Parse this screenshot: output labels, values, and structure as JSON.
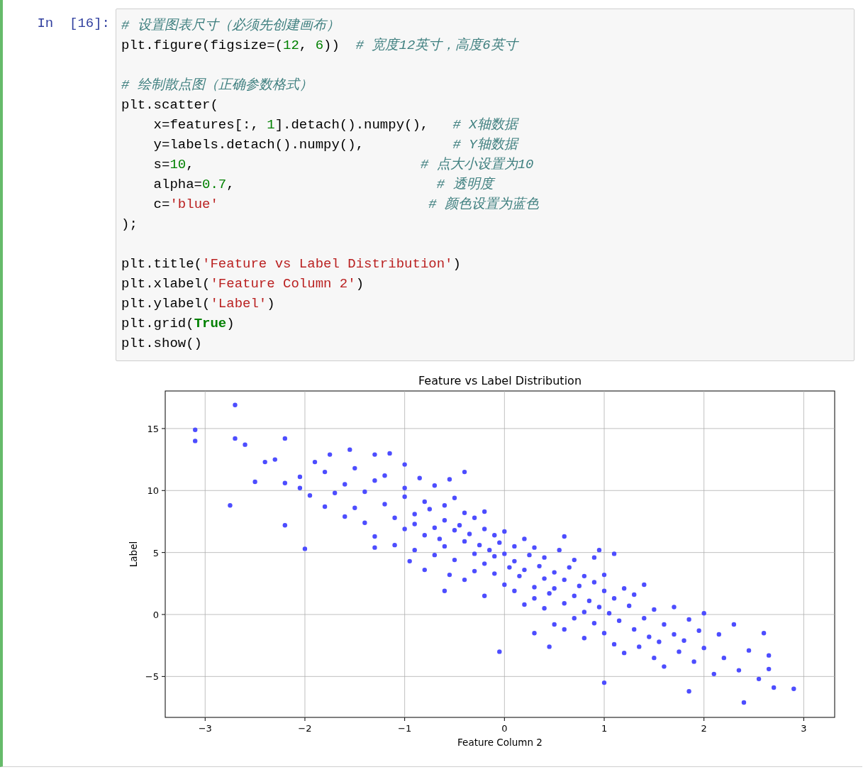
{
  "cell": {
    "prompt": "In  [16]:",
    "code_blocks": [
      [
        [
          {
            "kind": "comment",
            "text": "# 设置图表尺寸（必须先创建画布）"
          }
        ],
        [
          {
            "kind": "plain",
            "text": "plt.figure(figsize=("
          },
          {
            "kind": "number",
            "text": "12"
          },
          {
            "kind": "plain",
            "text": ", "
          },
          {
            "kind": "number",
            "text": "6"
          },
          {
            "kind": "plain",
            "text": "))  "
          },
          {
            "kind": "comment",
            "text": "# 宽度12英寸，高度6英寸"
          }
        ]
      ],
      [
        [
          {
            "kind": "comment",
            "text": "# 绘制散点图（正确参数格式）"
          }
        ],
        [
          {
            "kind": "plain",
            "text": "plt.scatter("
          }
        ],
        [
          {
            "kind": "plain",
            "text": "    x=features[:, "
          },
          {
            "kind": "number",
            "text": "1"
          },
          {
            "kind": "plain",
            "text": "].detach().numpy(),   "
          },
          {
            "kind": "comment",
            "text": "# X轴数据"
          }
        ],
        [
          {
            "kind": "plain",
            "text": "    y=labels.detach().numpy(),           "
          },
          {
            "kind": "comment",
            "text": "# Y轴数据"
          }
        ],
        [
          {
            "kind": "plain",
            "text": "    s="
          },
          {
            "kind": "number",
            "text": "10"
          },
          {
            "kind": "plain",
            "text": ",                            "
          },
          {
            "kind": "comment",
            "text": "# 点大小设置为10"
          }
        ],
        [
          {
            "kind": "plain",
            "text": "    alpha="
          },
          {
            "kind": "number",
            "text": "0.7"
          },
          {
            "kind": "plain",
            "text": ",                         "
          },
          {
            "kind": "comment",
            "text": "# 透明度"
          }
        ],
        [
          {
            "kind": "plain",
            "text": "    c="
          },
          {
            "kind": "string",
            "text": "'blue'"
          },
          {
            "kind": "comment",
            "text": "                          # 颜色设置为蓝色"
          }
        ],
        [
          {
            "kind": "plain",
            "text": ");"
          }
        ]
      ],
      [
        [
          {
            "kind": "plain",
            "text": "plt.title("
          },
          {
            "kind": "string",
            "text": "'Feature vs Label Distribution'"
          },
          {
            "kind": "plain",
            "text": ")"
          }
        ],
        [
          {
            "kind": "plain",
            "text": "plt.xlabel("
          },
          {
            "kind": "string",
            "text": "'Feature Column 2'"
          },
          {
            "kind": "plain",
            "text": ")"
          }
        ],
        [
          {
            "kind": "plain",
            "text": "plt.ylabel("
          },
          {
            "kind": "string",
            "text": "'Label'"
          },
          {
            "kind": "plain",
            "text": ")"
          }
        ],
        [
          {
            "kind": "plain",
            "text": "plt.grid("
          },
          {
            "kind": "keyword",
            "text": "True"
          },
          {
            "kind": "plain",
            "text": ")"
          }
        ],
        [
          {
            "kind": "plain",
            "text": "plt.show()"
          }
        ]
      ]
    ],
    "output": {
      "chart_data": {
        "type": "scatter",
        "title": "Feature vs Label Distribution",
        "xlabel": "Feature Column 2",
        "ylabel": "Label",
        "grid": true,
        "xlim": [
          -3.4,
          3.31
        ],
        "ylim": [
          -8.3,
          18.03
        ],
        "xticks": [
          {
            "value": -3,
            "label": "−3"
          },
          {
            "value": -2,
            "label": "−2"
          },
          {
            "value": -1,
            "label": "−1"
          },
          {
            "value": 0,
            "label": "0"
          },
          {
            "value": 1,
            "label": "1"
          },
          {
            "value": 2,
            "label": "2"
          },
          {
            "value": 3,
            "label": "3"
          }
        ],
        "yticks": [
          {
            "value": -5,
            "label": "−5"
          },
          {
            "value": 0,
            "label": "0"
          },
          {
            "value": 5,
            "label": "5"
          },
          {
            "value": 10,
            "label": "10"
          },
          {
            "value": 15,
            "label": "15"
          }
        ],
        "x": [
          -3.1,
          -3.1,
          -2.7,
          -2.7,
          -2.6,
          -2.75,
          -2.2,
          -2.0,
          -2.2,
          -2.3,
          -2.5,
          -2.2,
          -0.05,
          2.9,
          2.7,
          2.4,
          2.6,
          1.0,
          1.85,
          2.0,
          -1.55,
          -1.9,
          -1.3,
          -0.4,
          -1.8,
          -1.7,
          -1.6,
          -1.5,
          -1.5,
          -1.4,
          -1.4,
          -1.3,
          -1.3,
          -1.2,
          -1.2,
          -1.1,
          -1.1,
          -1.0,
          -1.0,
          -1.0,
          -0.9,
          -0.9,
          -0.9,
          -0.8,
          -0.8,
          -0.8,
          -0.75,
          -0.7,
          -0.7,
          -0.7,
          -0.65,
          -0.6,
          -0.6,
          -0.6,
          -0.55,
          -0.5,
          -0.5,
          -0.5,
          -0.45,
          -0.4,
          -0.4,
          -0.4,
          -0.35,
          -0.3,
          -0.3,
          -0.3,
          -0.25,
          -0.2,
          -0.2,
          -0.2,
          -0.15,
          -0.1,
          -0.1,
          -0.1,
          -0.05,
          0,
          0,
          0,
          0.05,
          0.1,
          0.1,
          0.1,
          0.15,
          0.2,
          0.2,
          0.2,
          0.25,
          0.3,
          0.3,
          0.3,
          0.35,
          0.4,
          0.4,
          0.4,
          0.45,
          0.5,
          0.5,
          0.5,
          0.55,
          0.6,
          0.6,
          0.6,
          0.65,
          0.7,
          0.7,
          0.7,
          0.75,
          0.8,
          0.8,
          0.8,
          0.85,
          0.9,
          0.9,
          0.9,
          0.95,
          1.0,
          1.0,
          1.0,
          1.05,
          1.1,
          1.1,
          1.15,
          1.2,
          1.2,
          1.25,
          1.3,
          1.3,
          1.35,
          1.4,
          1.4,
          1.45,
          1.5,
          1.5,
          1.55,
          1.6,
          1.6,
          1.7,
          1.7,
          1.75,
          1.8,
          1.85,
          1.9,
          1.95,
          2.0,
          2.1,
          2.15,
          2.2,
          2.3,
          2.35,
          2.45,
          2.55,
          2.65,
          2.65,
          -1.95,
          -2.05,
          -2.4,
          -1.75,
          -1.15,
          -0.85,
          -1.0,
          -0.55,
          -1.6,
          -1.3,
          -0.95,
          -0.6,
          -0.2,
          0.3,
          0.45,
          0.6,
          0.95,
          1.1,
          -2.05,
          -1.8
        ],
        "series": [
          {
            "color": "#4d4dff",
            "values": [
              14.9,
              14,
              16.9,
              14.2,
              13.7,
              8.8,
              7.2,
              5.3,
              14.2,
              12.5,
              10.7,
              10.6,
              -3,
              -6,
              -5.9,
              -7.1,
              -1.5,
              -5.5,
              -6.2,
              0.1,
              13.3,
              12.3,
              12.9,
              11.5,
              11.5,
              9.8,
              10.5,
              8.6,
              11.8,
              7.4,
              9.9,
              10.8,
              6.3,
              8.9,
              11.2,
              7.8,
              5.6,
              9.5,
              6.9,
              10.2,
              8.1,
              5.2,
              7.3,
              9.1,
              6.4,
              3.6,
              8.5,
              7.0,
              10.4,
              4.8,
              6.1,
              8.8,
              5.5,
              7.6,
              3.2,
              6.8,
              9.4,
              4.4,
              7.2,
              5.9,
              8.2,
              2.8,
              6.5,
              4.9,
              7.8,
              3.5,
              5.6,
              6.9,
              4.1,
              8.3,
              5.2,
              3.3,
              6.4,
              4.7,
              5.8,
              2.4,
              4.9,
              6.7,
              3.8,
              5.5,
              1.9,
              4.3,
              3.1,
              6.1,
              0.8,
              3.6,
              4.8,
              2.2,
              5.4,
              1.3,
              3.9,
              0.5,
              2.9,
              4.6,
              1.7,
              3.4,
              -0.8,
              2.1,
              5.2,
              0.9,
              2.8,
              -1.2,
              3.8,
              1.5,
              -0.3,
              4.4,
              2.3,
              0.2,
              3.1,
              -1.9,
              1.1,
              2.6,
              -0.7,
              4.6,
              0.6,
              1.9,
              -1.5,
              3.2,
              0.1,
              -2.4,
              1.3,
              -0.5,
              2.1,
              -3.1,
              0.7,
              -1.2,
              1.6,
              -2.6,
              -0.3,
              2.4,
              -1.8,
              -3.5,
              0.4,
              -2.2,
              -0.8,
              -4.2,
              -1.6,
              0.6,
              -3.0,
              -2.1,
              -0.4,
              -3.8,
              -1.3,
              -2.7,
              -4.8,
              -1.6,
              -3.5,
              -0.8,
              -4.5,
              -2.9,
              -5.2,
              -3.3,
              -4.4,
              9.6,
              11.1,
              12.3,
              12.9,
              13.0,
              11.0,
              12.1,
              10.9,
              7.9,
              5.4,
              4.3,
              1.9,
              1.5,
              -1.5,
              -2.6,
              6.3,
              5.2,
              4.9,
              10.2,
              8.7
            ]
          }
        ]
      }
    }
  }
}
